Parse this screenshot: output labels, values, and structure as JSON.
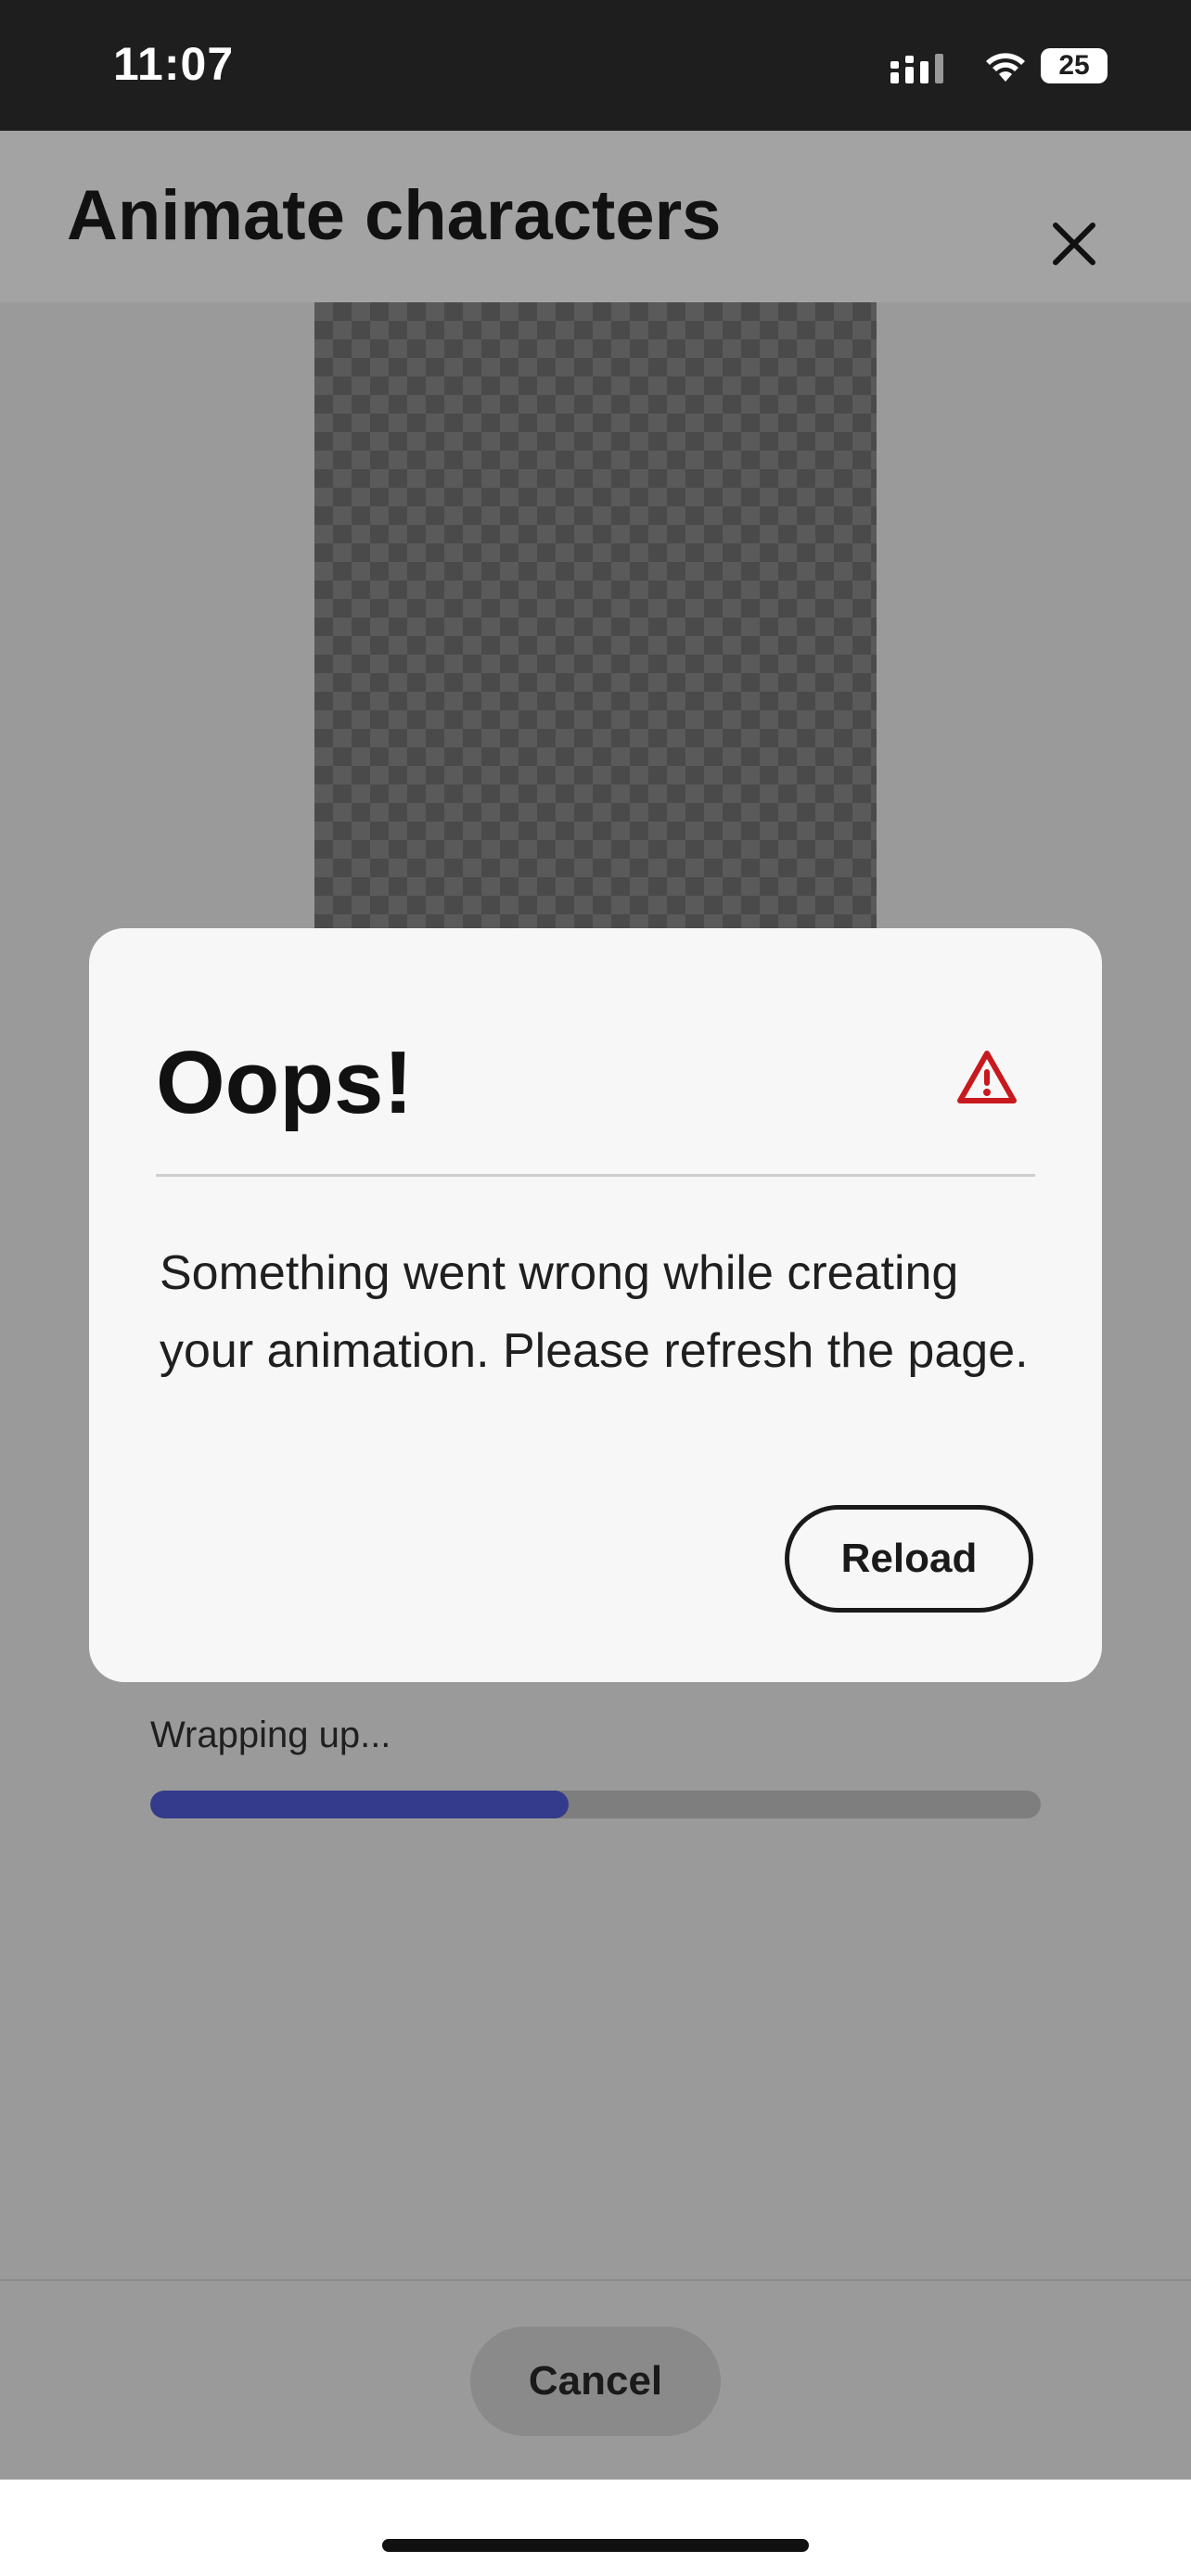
{
  "status_bar": {
    "time": "11:07",
    "battery": "25"
  },
  "header": {
    "title": "Animate characters"
  },
  "progress": {
    "label": "Wrapping up...",
    "fraction": 0.47,
    "fill_color": "#343a8c"
  },
  "footer": {
    "cancel_label": "Cancel"
  },
  "dialog": {
    "title": "Oops!",
    "message": "Something went wrong while creating your animation. Please refresh the page.",
    "reload_label": "Reload",
    "alert_color": "#c8191e"
  }
}
